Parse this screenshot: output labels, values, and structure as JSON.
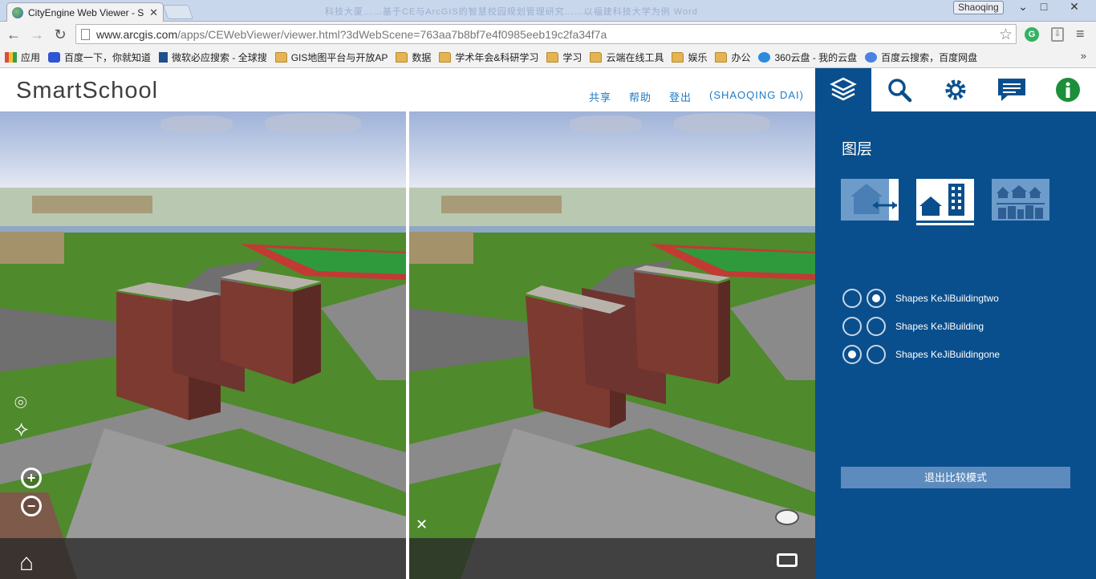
{
  "browser": {
    "tab_title": "CityEngine Web Viewer - S",
    "tab_close": "✕",
    "window_title_blurred": "科技大厦……基于CE与ArcGIS的智慧校园规划管理研究……以福建科技大学为例 Word",
    "user": "Shaoqing",
    "window_controls": [
      "⌄",
      "□",
      "✕"
    ],
    "url_host": "www.arcgis.com",
    "url_path": "/apps/CEWebViewer/viewer.html?3dWebScene=763aa7b8bf7e4f0985eeb19c2fa34f7a",
    "extension_label": "G",
    "menu_icon": "≡",
    "bookmarks_more": "»",
    "bookmarks": [
      {
        "icon": "apps",
        "label": "应用"
      },
      {
        "icon": "baidu",
        "label": "百度一下，你就知道"
      },
      {
        "icon": "bing",
        "label": "微软必应搜索 - 全球搜"
      },
      {
        "icon": "folder",
        "label": "GIS地图平台与开放AP"
      },
      {
        "icon": "folder",
        "label": "数据"
      },
      {
        "icon": "folder",
        "label": "学术年会&科研学习"
      },
      {
        "icon": "folder",
        "label": "学习"
      },
      {
        "icon": "folder",
        "label": "云端在线工具"
      },
      {
        "icon": "folder",
        "label": "娱乐"
      },
      {
        "icon": "folder",
        "label": "办公"
      },
      {
        "icon": "cloud360",
        "label": "360云盘 - 我的云盘"
      },
      {
        "icon": "baiduyun",
        "label": "百度云搜索，百度网盘"
      }
    ]
  },
  "app": {
    "logo": "SmartSchool",
    "links": [
      "共享",
      "帮助",
      "登出",
      "(SHAOQING DAI)"
    ]
  },
  "viewer": {
    "close_compare": "✕",
    "zoom_in": "+",
    "zoom_out": "−"
  },
  "panel": {
    "title": "图层",
    "tabs": [
      "layers-icon",
      "search-icon",
      "gear-icon",
      "comment-icon",
      "info-icon"
    ],
    "layers": [
      {
        "name": "Shapes KeJiBuildingtwo",
        "left_selected": false,
        "right_selected": true
      },
      {
        "name": "Shapes KeJiBuilding",
        "left_selected": false,
        "right_selected": false
      },
      {
        "name": "Shapes KeJiBuildingone",
        "left_selected": true,
        "right_selected": false
      }
    ],
    "exit_button": "退出比较模式"
  },
  "colors": {
    "panel_bg": "#0a4f8d",
    "link": "#1e7bc7",
    "mode_inactive": "#6d9ccb",
    "exit_btn": "#5d8bbd"
  }
}
